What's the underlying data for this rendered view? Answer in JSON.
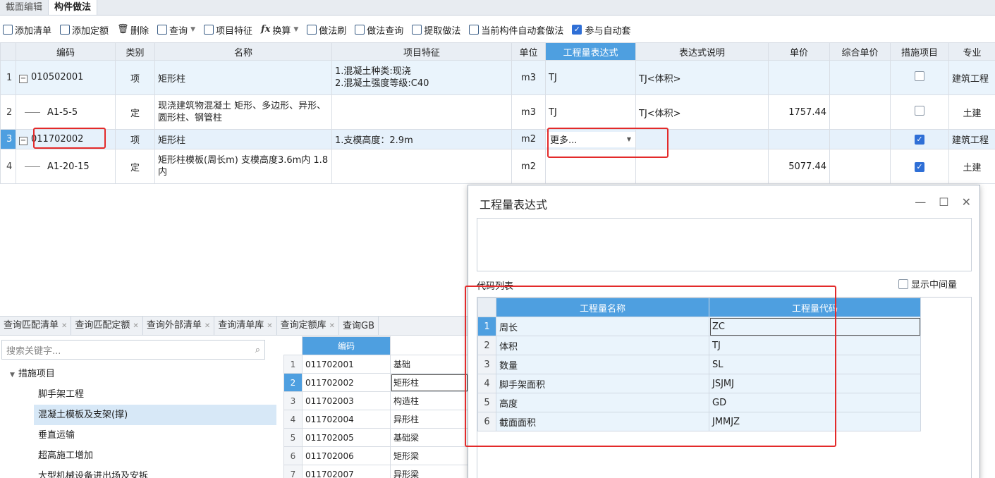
{
  "top_tabs": [
    "截面编辑",
    "构件做法"
  ],
  "toolbar": {
    "add_list": "添加清单",
    "add_quota": "添加定额",
    "delete": "删除",
    "query": "查询",
    "item_feature": "项目特征",
    "convert": "换算",
    "method_brush": "做法刷",
    "method_query": "做法查询",
    "extract_method": "提取做法",
    "auto_apply": "当前构件自动套做法",
    "participate_auto": "参与自动套"
  },
  "grid": {
    "headers": [
      "编码",
      "类别",
      "名称",
      "项目特征",
      "单位",
      "工程量表达式",
      "表达式说明",
      "单价",
      "综合单价",
      "措施项目",
      "专业"
    ],
    "rows": [
      {
        "num": "1",
        "code": "010502001",
        "type": "项",
        "name": "矩形柱",
        "feature": "1.混凝土种类:现浇\n2.混凝土强度等级:C40",
        "unit": "m3",
        "expr": "TJ",
        "desc": "TJ<体积>",
        "price": "",
        "total": "",
        "measure": false,
        "major": "建筑工程"
      },
      {
        "num": "2",
        "code": "A1-5-5",
        "type": "定",
        "name": "现浇建筑物混凝土 矩形、多边形、异形、圆形柱、钢管柱",
        "feature": "",
        "unit": "m3",
        "expr": "TJ",
        "desc": "TJ<体积>",
        "price": "1757.44",
        "total": "",
        "measure": false,
        "major": "土建"
      },
      {
        "num": "3",
        "code": "011702002",
        "type": "项",
        "name": "矩形柱",
        "feature": "1.支模高度：2.9m",
        "unit": "m2",
        "expr": "更多...",
        "desc": "",
        "price": "",
        "total": "",
        "measure": true,
        "major": "建筑工程"
      },
      {
        "num": "4",
        "code": "A1-20-15",
        "type": "定",
        "name": "矩形柱模板(周长m) 支模高度3.6m内 1.8内",
        "feature": "",
        "unit": "m2",
        "expr": "",
        "desc": "",
        "price": "5077.44",
        "total": "",
        "measure": true,
        "major": "土建"
      }
    ]
  },
  "bottom_tabs": [
    "查询匹配清单",
    "查询匹配定额",
    "查询外部清单",
    "查询清单库",
    "查询定额库",
    "查询GB"
  ],
  "search": {
    "placeholder": "搜索关键字..."
  },
  "tree": {
    "root": "措施项目",
    "children": [
      "脚手架工程",
      "混凝土模板及支架(撑)",
      "垂直运输",
      "超高施工增加",
      "大型机械设备进出场及安拆"
    ]
  },
  "code_table": {
    "header": "编码",
    "rows": [
      {
        "n": "1",
        "code": "011702001",
        "name": "基础"
      },
      {
        "n": "2",
        "code": "011702002",
        "name": "矩形柱"
      },
      {
        "n": "3",
        "code": "011702003",
        "name": "构造柱"
      },
      {
        "n": "4",
        "code": "011702004",
        "name": "异形柱"
      },
      {
        "n": "5",
        "code": "011702005",
        "name": "基础梁"
      },
      {
        "n": "6",
        "code": "011702006",
        "name": "矩形梁"
      },
      {
        "n": "7",
        "code": "011702007",
        "name": "异形梁"
      }
    ]
  },
  "dialog": {
    "title": "工程量表达式",
    "code_list_label": "代码列表",
    "show_intermediate": "显示中间量",
    "headers": [
      "工程量名称",
      "工程量代码"
    ],
    "rows": [
      {
        "n": "1",
        "name": "周长",
        "code": "ZC"
      },
      {
        "n": "2",
        "name": "体积",
        "code": "TJ"
      },
      {
        "n": "3",
        "name": "数量",
        "code": "SL"
      },
      {
        "n": "4",
        "name": "脚手架面积",
        "code": "JSJMJ"
      },
      {
        "n": "5",
        "name": "高度",
        "code": "GD"
      },
      {
        "n": "6",
        "name": "截面面积",
        "code": "JMMJZ"
      }
    ]
  },
  "colors": {
    "accent": "#4e9fe0",
    "highlight_box": "#e32a2a",
    "check": "#2f6fd6"
  }
}
